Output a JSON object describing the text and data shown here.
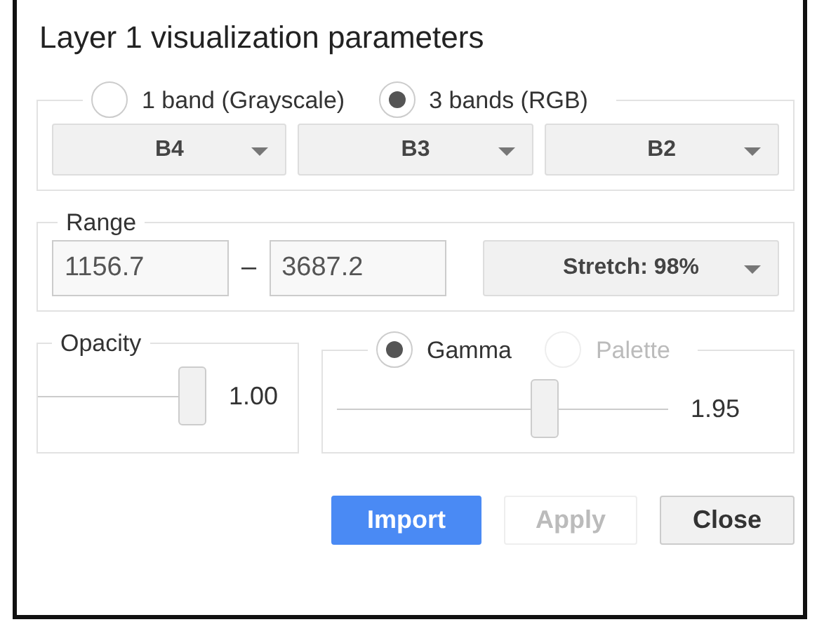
{
  "dialog": {
    "title": "Layer 1 visualization parameters"
  },
  "band_mode": [
    {
      "label": "1 band (Grayscale)",
      "selected": false
    },
    {
      "label": "3 bands (RGB)",
      "selected": true
    }
  ],
  "bands": [
    "B4",
    "B3",
    "B2"
  ],
  "range": {
    "legend": "Range",
    "min": "1156.7",
    "separator": "–",
    "max": "3687.2",
    "stretch": "Stretch: 98%"
  },
  "opacity": {
    "legend": "Opacity",
    "level": 1,
    "reading": "1.00"
  },
  "render_mode": [
    {
      "label": "Gamma",
      "selected": true,
      "disabled": false
    },
    {
      "label": "Palette",
      "selected": false,
      "disabled": true
    }
  ],
  "gamma": {
    "level": 0.64,
    "reading": "1.95"
  },
  "buttons": [
    {
      "label": "Import",
      "kind": "primary",
      "disabled": false
    },
    {
      "label": "Apply",
      "kind": "secondary",
      "disabled": true
    },
    {
      "label": "Close",
      "kind": "secondary",
      "disabled": false
    }
  ]
}
